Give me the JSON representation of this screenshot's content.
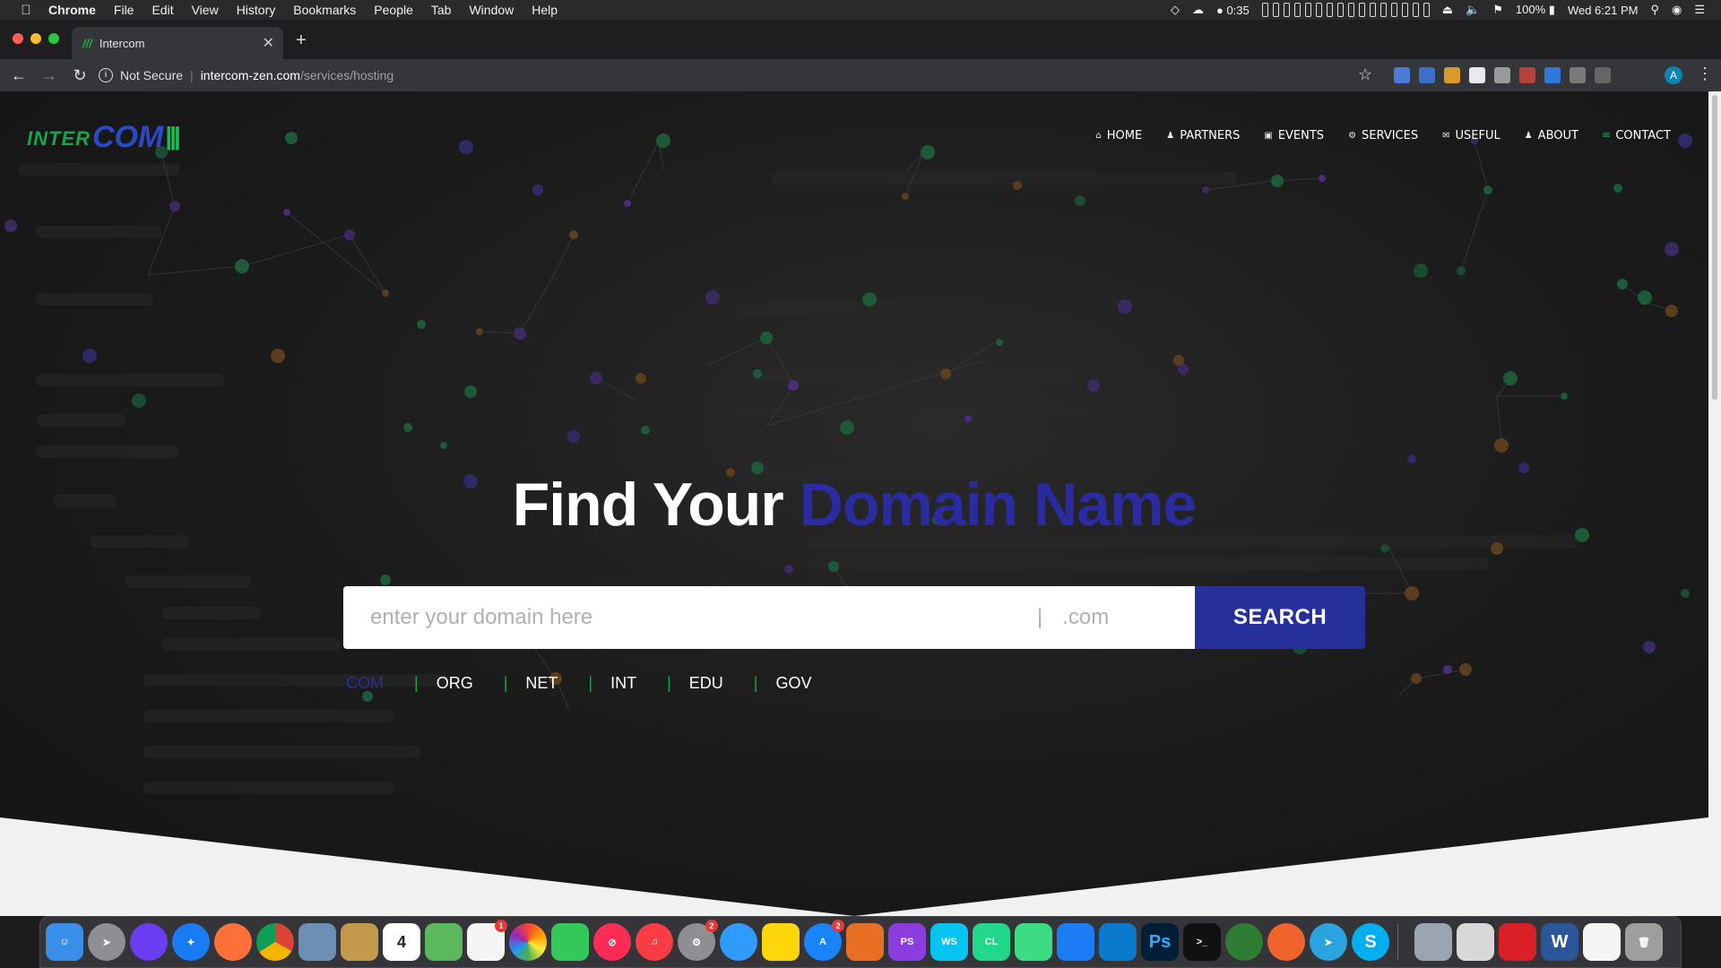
{
  "menubar": {
    "app": "Chrome",
    "items": [
      "File",
      "Edit",
      "View",
      "History",
      "Bookmarks",
      "People",
      "Tab",
      "Window",
      "Help"
    ],
    "timer": "0:35",
    "battery": "100%",
    "clock": "Wed 6:21 PM"
  },
  "browser": {
    "tab_title": "Intercom",
    "not_secure": "Not Secure",
    "url_host": "intercom-zen.com",
    "url_path": "/services/hosting",
    "profile_initial": "A"
  },
  "site": {
    "logo_text_1": "INTER",
    "logo_text_2": "COM",
    "nav": [
      {
        "label": "HOME",
        "icon": "home-icon"
      },
      {
        "label": "PARTNERS",
        "icon": "user-icon"
      },
      {
        "label": "EVENTS",
        "icon": "picture-icon"
      },
      {
        "label": "SERVICES",
        "icon": "gear-icon"
      },
      {
        "label": "USEFUL",
        "icon": "chat-icon"
      },
      {
        "label": "ABOUT",
        "icon": "user-icon"
      },
      {
        "label": "CONTACT",
        "icon": "envelope-icon"
      }
    ],
    "hero": {
      "title_white": "Find Your",
      "title_blue": "Domain Name"
    },
    "search": {
      "placeholder": "enter your domain here",
      "divider": "|",
      "tld": ".com",
      "button": "SEARCH"
    },
    "tlds": [
      "COM",
      "ORG",
      "NET",
      "INT",
      "EDU",
      "GOV"
    ],
    "active_tld": "COM",
    "colors": {
      "accent_blue": "#25309a",
      "accent_green": "#1ca24b"
    }
  },
  "dock": {
    "apps": [
      {
        "name": "Finder",
        "color": "#3b8ee8"
      },
      {
        "name": "Launchpad",
        "color": "#8e8e93"
      },
      {
        "name": "Siri",
        "color": "#6a3df0"
      },
      {
        "name": "Safari",
        "color": "#1a7cf5"
      },
      {
        "name": "Firefox",
        "color": "#ff7139"
      },
      {
        "name": "Chrome",
        "color": "#4caf50"
      },
      {
        "name": "Preview",
        "color": "#6b8fb5"
      },
      {
        "name": "Notes Folder",
        "color": "#c39a4b"
      },
      {
        "name": "Calendar",
        "color": "#ffffff"
      },
      {
        "name": "Maps",
        "color": "#5cb85c"
      },
      {
        "name": "Reminders",
        "color": "#f5f5f5"
      },
      {
        "name": "Photos",
        "color": "#f0a030"
      },
      {
        "name": "FaceTime",
        "color": "#34c759"
      },
      {
        "name": "News",
        "color": "#ff2d55"
      },
      {
        "name": "Music",
        "color": "#fc3c44"
      },
      {
        "name": "System Preferences",
        "color": "#8e8e93"
      },
      {
        "name": "Messages",
        "color": "#2f9bff"
      },
      {
        "name": "Notes",
        "color": "#ffd60a"
      },
      {
        "name": "App Store",
        "color": "#1a84ff"
      },
      {
        "name": "MATLAB",
        "color": "#e76f24"
      },
      {
        "name": "PhpStorm",
        "color": "#8b3de0"
      },
      {
        "name": "WebStorm",
        "color": "#07c3f2"
      },
      {
        "name": "CLion",
        "color": "#21d789"
      },
      {
        "name": "Android Studio",
        "color": "#3ddc84"
      },
      {
        "name": "Xcode",
        "color": "#1c7cf4"
      },
      {
        "name": "VS Code",
        "color": "#0a7acc"
      },
      {
        "name": "Photoshop",
        "color": "#001e36"
      },
      {
        "name": "Terminal",
        "color": "#111111"
      },
      {
        "name": "Virus Scanner",
        "color": "#2e7d32"
      },
      {
        "name": "Swift Playgrounds",
        "color": "#f0642b"
      },
      {
        "name": "Telegram",
        "color": "#2aa3de"
      },
      {
        "name": "Skype",
        "color": "#00aff0"
      },
      {
        "name": "Screenshot Tool",
        "color": "#9aa5b1"
      },
      {
        "name": "TextEdit",
        "color": "#d8d8d8"
      },
      {
        "name": "Creative Cloud",
        "color": "#da1f26"
      },
      {
        "name": "Word",
        "color": "#2b579a"
      },
      {
        "name": "Document",
        "color": "#f5f5f5"
      },
      {
        "name": "Trash",
        "color": "#9e9e9e"
      }
    ],
    "labels": {
      "calendar_day": "4",
      "phpstorm": "PS",
      "webstorm": "WS",
      "clion": "CL",
      "photoshop": "Ps"
    },
    "badges": {
      "reminders": "1",
      "system_preferences": "2",
      "app_store": "2"
    }
  }
}
